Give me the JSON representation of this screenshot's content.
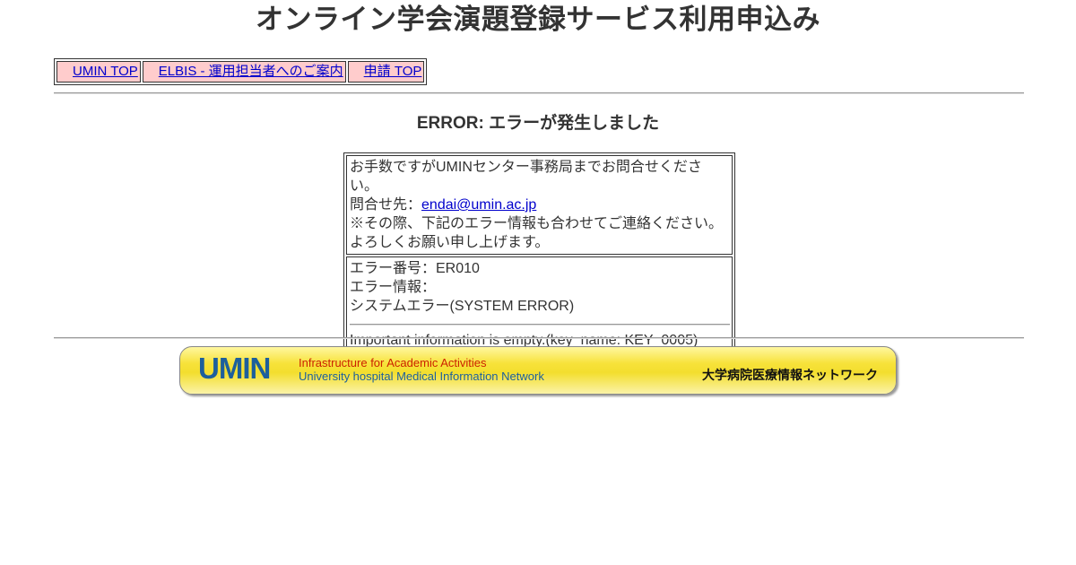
{
  "page": {
    "title": "オンライン学会演題登録サービス利用申込み"
  },
  "nav": {
    "items": [
      {
        "label": "UMIN TOP"
      },
      {
        "label": "ELBIS - 運用担当者へのご案内"
      },
      {
        "label": "申請 TOP"
      }
    ]
  },
  "error": {
    "heading": "ERROR: エラーが発生しました",
    "message": {
      "line1": "お手数ですがUMINセンター事務局までお問合せください。",
      "contact_label": "問合せ先：",
      "contact_email": "endai@umin.ac.jp",
      "line3": "※その際、下記のエラー情報も合わせてご連絡ください。",
      "line4": "よろしくお願い申し上げます。"
    },
    "details": {
      "number": "エラー番号：ER010",
      "info_label": "エラー情報：",
      "info_value": "システムエラー(SYSTEM ERROR)",
      "detail": "Important information is empty.(key_name: KEY_0005)"
    }
  },
  "banner": {
    "logo": "UMIN",
    "line1": "Infrastructure for Academic Activities",
    "line2": "University hospital Medical Information Network",
    "jp": "大学病院医療情報ネットワーク"
  }
}
